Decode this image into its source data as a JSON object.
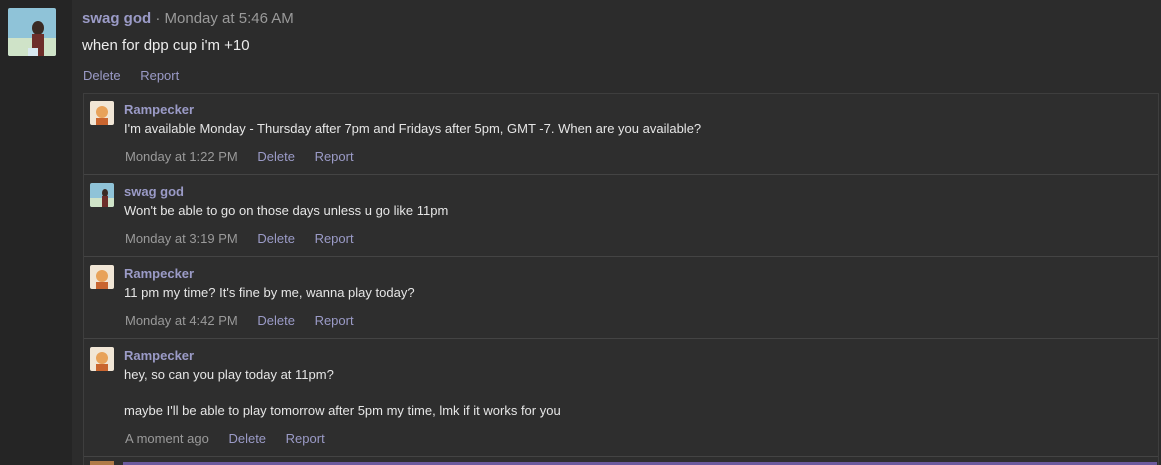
{
  "post": {
    "author": "swag god",
    "separator": "·",
    "time": "Monday at 5:46 AM",
    "body": "when for dpp cup i'm +10",
    "actions": [
      "Delete",
      "Report"
    ]
  },
  "replies": [
    {
      "author": "Rampecker",
      "avatar": "rampecker-avatar",
      "lines": [
        "I'm available Monday - Thursday after 7pm and Fridays after 5pm, GMT -7. When are you available?"
      ],
      "time": "Monday at 1:22 PM",
      "actions": [
        "Delete",
        "Report"
      ]
    },
    {
      "author": "swag god",
      "avatar": "swag-god-avatar",
      "lines": [
        "Won't be able to go on those days unless u go like 11pm"
      ],
      "time": "Monday at 3:19 PM",
      "actions": [
        "Delete",
        "Report"
      ]
    },
    {
      "author": "Rampecker",
      "avatar": "rampecker-avatar",
      "lines": [
        "11 pm my time? It's fine by me, wanna play today?"
      ],
      "time": "Monday at 4:42 PM",
      "actions": [
        "Delete",
        "Report"
      ]
    },
    {
      "author": "Rampecker",
      "avatar": "rampecker-avatar",
      "lines": [
        "hey, so can you play today at 11pm?",
        "maybe I'll be able to play tomorrow after 5pm my time, lmk if it works for you"
      ],
      "time": "A moment ago",
      "actions": [
        "Delete",
        "Report"
      ]
    }
  ],
  "colors": {
    "accent": "#9b9bc7",
    "background": "#2c2c2c",
    "muted": "#9a9a9a"
  }
}
